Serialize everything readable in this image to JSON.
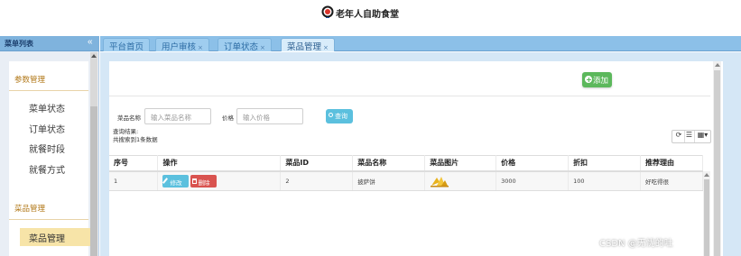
{
  "header": {
    "title": "老年人自助食堂"
  },
  "sidebar": {
    "title": "菜单列表",
    "collapse_glyph": "«",
    "groups": [
      {
        "title": "参数管理",
        "items": [
          "菜单状态",
          "订单状态",
          "就餐时段",
          "就餐方式"
        ]
      },
      {
        "title": "菜品管理",
        "items": [
          "菜品管理"
        ]
      }
    ]
  },
  "tabs": [
    {
      "label": "平台首页",
      "closable": false,
      "active": false
    },
    {
      "label": "用户审核",
      "closable": true,
      "active": false
    },
    {
      "label": "订单状态",
      "closable": true,
      "active": false
    },
    {
      "label": "菜品管理",
      "closable": true,
      "active": true
    }
  ],
  "tab_close_glyph": "×",
  "toolbar": {
    "add_label": "添加"
  },
  "search": {
    "name_label": "菜品名称",
    "name_placeholder": "输入菜品名称",
    "price_label": "价格",
    "price_placeholder": "输入价格",
    "query_label": "查询"
  },
  "results": {
    "line1": "查询结果:",
    "line2": "共搜索到1条数据"
  },
  "table_tools": {
    "refresh": "⟳",
    "list": "☰",
    "columns": "▦▾"
  },
  "table": {
    "columns": [
      "序号",
      "操作",
      "菜品ID",
      "菜品名称",
      "菜品图片",
      "价格",
      "折扣",
      "推荐理由"
    ],
    "rows": [
      {
        "index": "1",
        "edit_label": "修改",
        "delete_label": "删除",
        "id": "2",
        "name": "披萨饼",
        "image": "food-image",
        "price": "3000",
        "discount": "100",
        "reason": "好吃得很"
      }
    ]
  },
  "watermark": "CSDN @无忧的吐",
  "colors": {
    "accent": "#8cc0e8",
    "add": "#5cb85c",
    "query": "#5bc0de",
    "delete": "#d9534f",
    "active_menu": "#f7e4a8"
  }
}
